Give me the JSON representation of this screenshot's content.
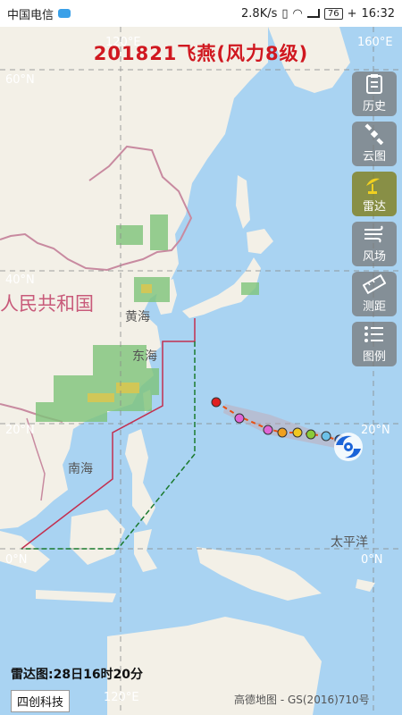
{
  "status_bar": {
    "carrier": "中国电信",
    "speed": "2.8K/s",
    "battery": "76",
    "time": "16:32"
  },
  "title": "201821飞燕(风力8级)",
  "grid_labels": {
    "lon_160": "160°E",
    "lon_120_top": "120°E",
    "lon_120_bottom": "120°E",
    "lat_60": "60°N",
    "lat_40": "40°N",
    "lat_20_left": "20°N",
    "lat_20_right": "20°N",
    "lat_0_left": "0°N",
    "lat_0_right": "0°N"
  },
  "region_labels": {
    "country": "人民共和国",
    "yellow_sea": "黄海",
    "east_sea": "东海",
    "south_sea": "南海",
    "pacific": "太平洋"
  },
  "toolbar": {
    "history": "历史",
    "cloud": "云图",
    "radar": "雷达",
    "wind": "风场",
    "measure": "测距",
    "legend": "图例"
  },
  "radar_time": "雷达图:28日16时20分",
  "brand": "四创科技",
  "map_credit": "高德地图 - GS(2016)710号",
  "colors": {
    "title": "#d01820",
    "ocean": "#a9d3f2",
    "land": "#f3f0e7",
    "warning_24h": "#c33050",
    "warning_48h": "#1b7a2e"
  }
}
